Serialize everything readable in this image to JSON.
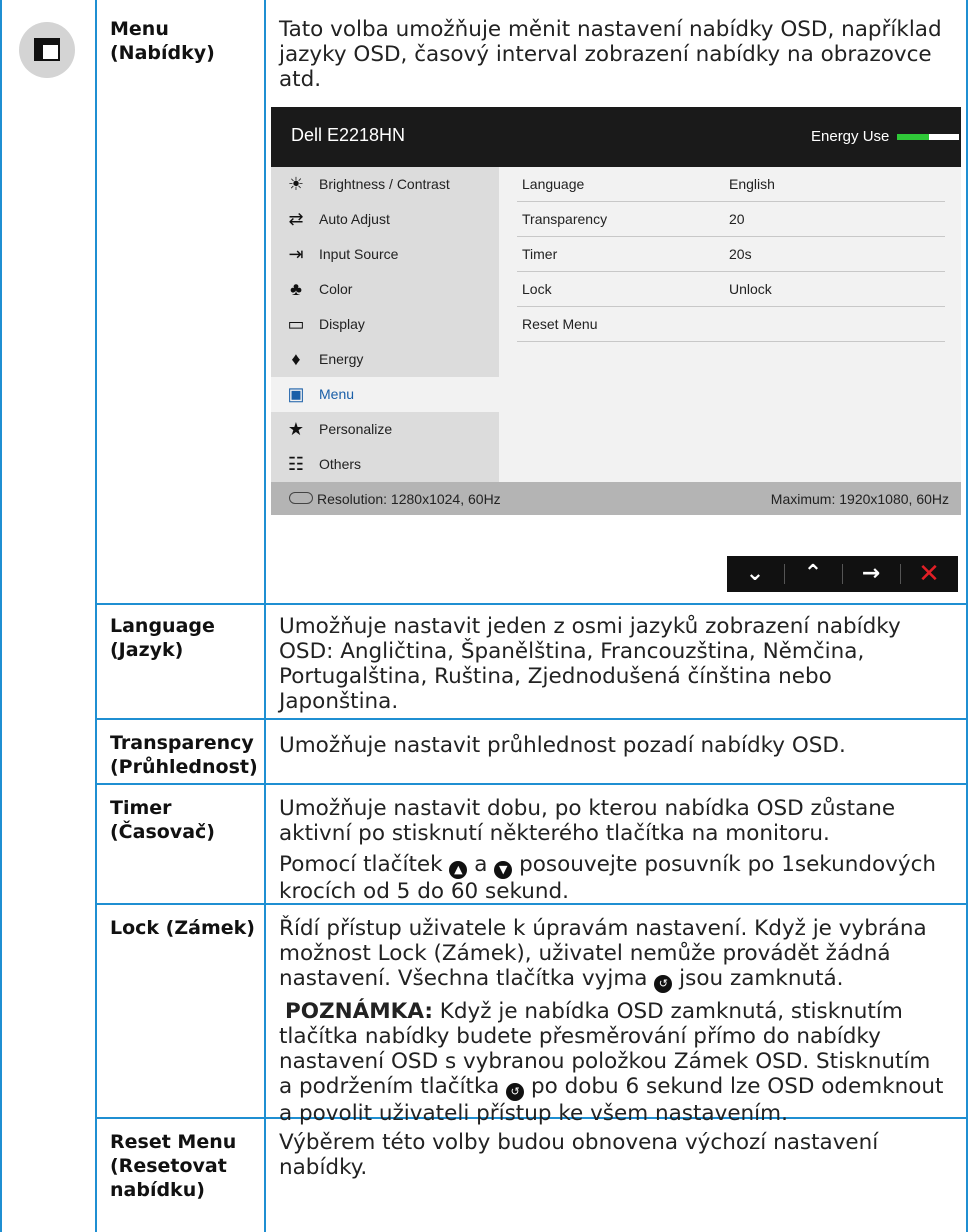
{
  "rows": [
    {
      "label_line1": "Menu",
      "label_line2": "(Nabídky)",
      "description": "Tato volba umožňuje měnit nastavení nabídky OSD, například jazyky OSD, časový interval zobrazení nabídky na obrazovce atd."
    },
    {
      "label_line1": "Language",
      "label_line2": "(Jazyk)",
      "description": "Umožňuje nastavit jeden z osmi jazyků zobrazení nabídky OSD: Angličtina, Španělština, Francouzština, Němčina, Portugalština, Ruština, Zjednodušená čínština nebo Japonština."
    },
    {
      "label_line1": "Transparency",
      "label_line2": "(Průhlednost)",
      "description": "Umožňuje nastavit průhlednost pozadí nabídky OSD."
    },
    {
      "label_line1": "Timer",
      "label_line2": "(Časovač)",
      "description_p1": "Umožňuje nastavit dobu, po kterou nabídka OSD zůstane aktivní po stisknutí některého tlačítka na monitoru.",
      "description_p2_a": "Pomocí tlačítek",
      "description_p2_b": "a",
      "description_p2_c": "posouvejte posuvník po 1sekundových krocích od 5 do 60 sekund."
    },
    {
      "label_line1": "Lock (Zámek)",
      "description_p1_a": "Řídí přístup uživatele k úpravám nastavení. Když je vybrána možnost Lock (Zámek), uživatel nemůže provádět žádná nastavení. Všechna tlačítka vyjma",
      "description_p1_b": "jsou zamknutá.",
      "note_label": "POZNÁMKA:",
      "note_a": "Když je nabídka OSD zamknutá, stisknutím tlačítka nabídky budete přesměrování přímo do nabídky nastavení OSD s vybranou položkou Zámek OSD. Stisknutím a podržením tlačítka",
      "note_b": "po dobu 6 sekund lze OSD odemknout a povolit uživateli přístup ke všem nastavením."
    },
    {
      "label_line1": "Reset Menu",
      "label_line2": "(Resetovat",
      "label_line3": "nabídku)",
      "description": "Výběrem této volby budou obnovena výchozí nastavení nabídky."
    }
  ],
  "osd": {
    "model": "Dell E2218HN",
    "energy_label": "Energy Use",
    "energy_level": 0.52,
    "menu_items": [
      {
        "label": "Brightness / Contrast",
        "icon": "brightness-icon"
      },
      {
        "label": "Auto Adjust",
        "icon": "auto-adjust-icon"
      },
      {
        "label": "Input Source",
        "icon": "input-source-icon"
      },
      {
        "label": "Color",
        "icon": "color-icon"
      },
      {
        "label": "Display",
        "icon": "display-icon"
      },
      {
        "label": "Energy",
        "icon": "energy-icon"
      },
      {
        "label": "Menu",
        "icon": "menu-icon",
        "active": true
      },
      {
        "label": "Personalize",
        "icon": "star-icon"
      },
      {
        "label": "Others",
        "icon": "others-icon"
      }
    ],
    "settings": [
      {
        "key": "Language",
        "value": "English"
      },
      {
        "key": "Transparency",
        "value": "20"
      },
      {
        "key": "Timer",
        "value": "20s"
      },
      {
        "key": "Lock",
        "value": "Unlock"
      },
      {
        "key": "Reset Menu",
        "value": ""
      }
    ],
    "resolution": "Resolution: 1280x1024, 60Hz",
    "maximum": "Maximum: 1920x1080, 60Hz",
    "buttons": [
      "down-arrow-icon",
      "up-arrow-icon",
      "right-arrow-icon",
      "close-icon"
    ]
  },
  "colors": {
    "table_border": "#1f8fd2",
    "energy_fill": "#2fc838",
    "exit_button": "#e21f26"
  }
}
